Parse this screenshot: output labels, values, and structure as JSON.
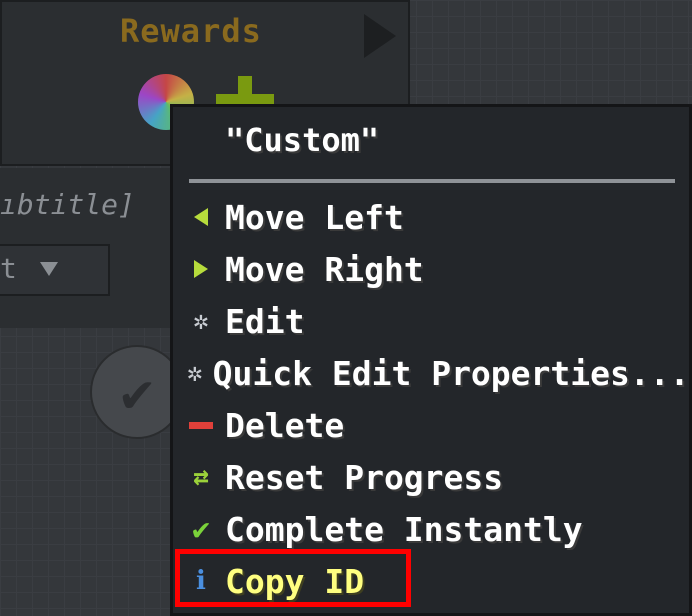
{
  "background": {
    "rewards_title": "Rewards",
    "subtitle_fragment": "ıbtitle]",
    "filter_fragment": "t"
  },
  "context_menu": {
    "title": "\"Custom\"",
    "items": [
      {
        "label": "Move Left",
        "icon": "arrow-left-icon"
      },
      {
        "label": "Move Right",
        "icon": "arrow-right-icon"
      },
      {
        "label": "Edit",
        "icon": "gear-icon"
      },
      {
        "label": "Quick Edit Properties...",
        "icon": "gear-icon"
      },
      {
        "label": "Delete",
        "icon": "minus-icon"
      },
      {
        "label": "Reset Progress",
        "icon": "reset-icon"
      },
      {
        "label": "Complete Instantly",
        "icon": "check-icon"
      },
      {
        "label": "Copy ID",
        "icon": "info-icon"
      }
    ]
  },
  "colors": {
    "menu_bg": "#23262a",
    "text": "#ffffff",
    "copy_id_text": "#ffff80",
    "highlight": "#ff0000",
    "rewards_title": "#8a6a1e"
  }
}
